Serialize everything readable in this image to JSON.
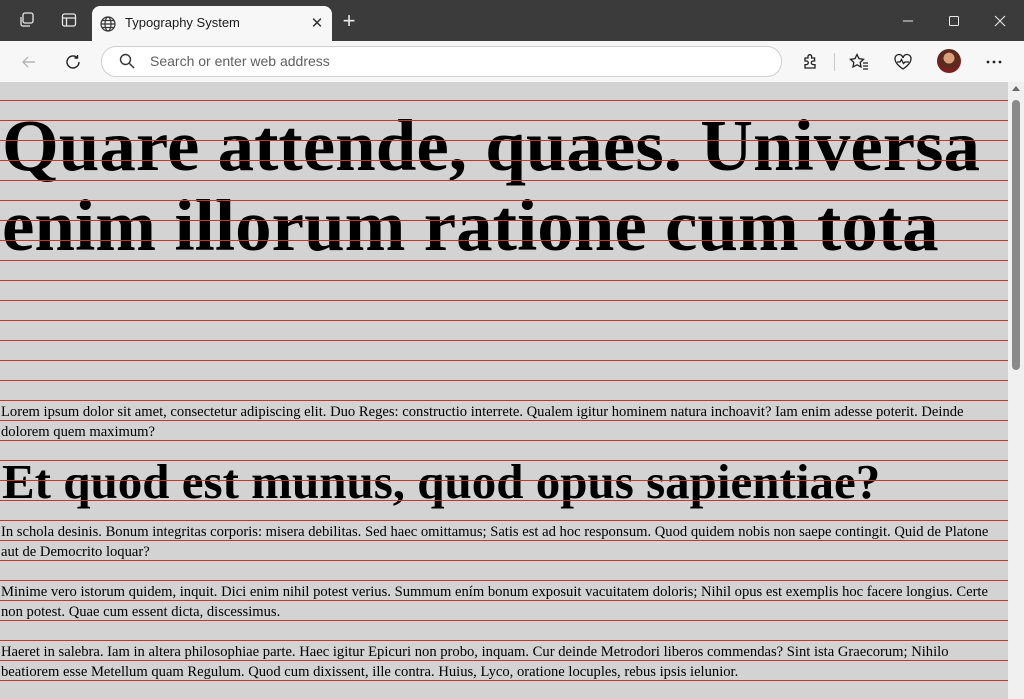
{
  "browser": {
    "tab_title": "Typography System",
    "tab_close": "✕",
    "new_tab": "+",
    "address_placeholder": "Search or enter web address"
  },
  "icons": [
    "workspaces-icon",
    "tab-actions-icon",
    "globe-icon",
    "close-icon",
    "new-tab-icon",
    "minimize-icon",
    "maximize-icon",
    "window-close-icon",
    "back-icon",
    "refresh-icon",
    "search-icon",
    "extensions-icon",
    "favorites-icon",
    "browser-essentials-icon",
    "profile-avatar",
    "more-icon"
  ],
  "colors": {
    "page_background": "#d3d3d3",
    "baseline_grid": "#c0392b",
    "titlebar": "#3b3b3b",
    "toolbar": "#f7f7f7"
  },
  "page": {
    "heading1": "Quare attende, quaes. Universa enim illorum ratione cum tota",
    "paragraph1": "Lorem ipsum dolor sit amet, consectetur adipiscing elit. Duo Reges: constructio interrete. Qualem igitur hominem natura inchoavit? Iam enim adesse poterit. Deinde dolorem quem maximum?",
    "heading2": "Et quod est munus, quod opus sapientiae?",
    "paragraph2": "In schola desinis. Bonum integritas corporis: misera debilitas. Sed haec omittamus; Satis est ad hoc responsum. Quod quidem nobis non saepe contingit. Quid de Platone aut de Democrito loquar?",
    "paragraph3": "Minime vero istorum quidem, inquit. Dici enim nihil potest verius. Summum ením bonum exposuit vacuitatem doloris; Nihil opus est exemplis hoc facere longius. Certe non potest. Quae cum essent dicta, discessimus.",
    "paragraph4": "Haeret in salebra. Iam in altera philosophiae parte. Haec igitur Epicuri non probo, inquam. Cur deinde Metrodori liberos commendas? Sint ista Graecorum; Nihilo beatiorem esse Metellum quam Regulum. Quod cum dixissent, ille contra. Huius, Lyco, oratione locuples, rebus ipsis ielunior."
  }
}
